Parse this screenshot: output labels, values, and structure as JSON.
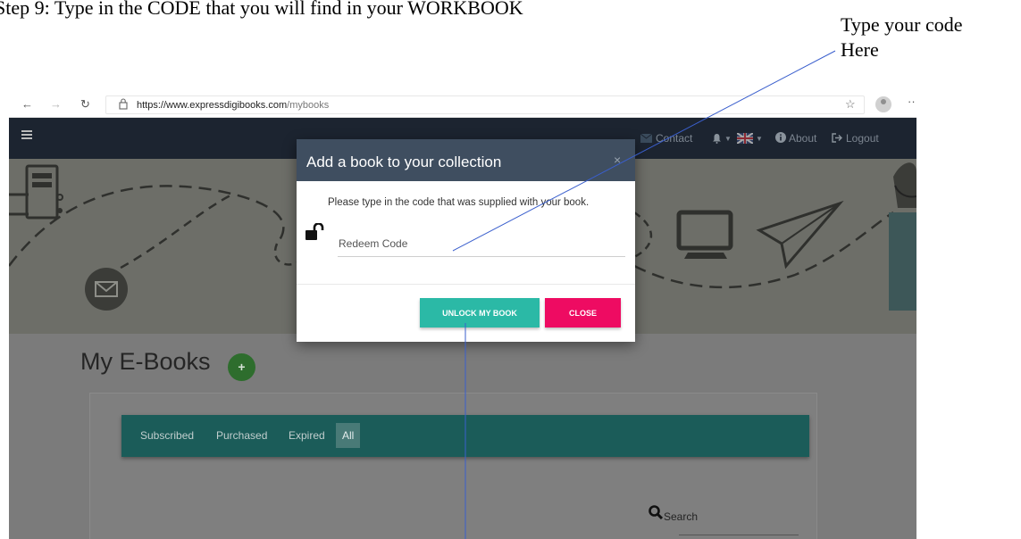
{
  "annotations": {
    "step_text": "Step 9: Type in the CODE that you will find in your WORKBOOK",
    "code_hint": "Type your code\nHere"
  },
  "browser": {
    "back_icon": "←",
    "forward_icon": "→",
    "refresh_icon": "↻",
    "lock_icon": "🔒",
    "url_host": "https://www.expressdigibooks.com",
    "url_path": "/mybooks",
    "favorite_icon": "☆",
    "more_icon": "···"
  },
  "navbar": {
    "contact": "Contact",
    "bell_icon": "🔔",
    "about": "About",
    "logout": "Logout"
  },
  "page": {
    "title": "My E-Books",
    "add_button_label": "+",
    "tabs": [
      "Subscribed",
      "Purchased",
      "Expired",
      "All"
    ],
    "active_tab": "All",
    "search_label": "Search"
  },
  "modal": {
    "title": "Add a book to your collection",
    "close_icon": "×",
    "instruction": "Please type in the code that was supplied with your book.",
    "input_placeholder": "Redeem Code",
    "input_value": "",
    "unlock_label": "UNLOCK MY BOOK",
    "close_label": "CLOSE"
  },
  "colors": {
    "navbar": "#1c2430",
    "modal_header": "#3f4e60",
    "unlock_button": "#2bb9a6",
    "close_button": "#ee0b62",
    "tab_bar": "#1b5c59",
    "annotation_line": "#3a5fcd"
  }
}
